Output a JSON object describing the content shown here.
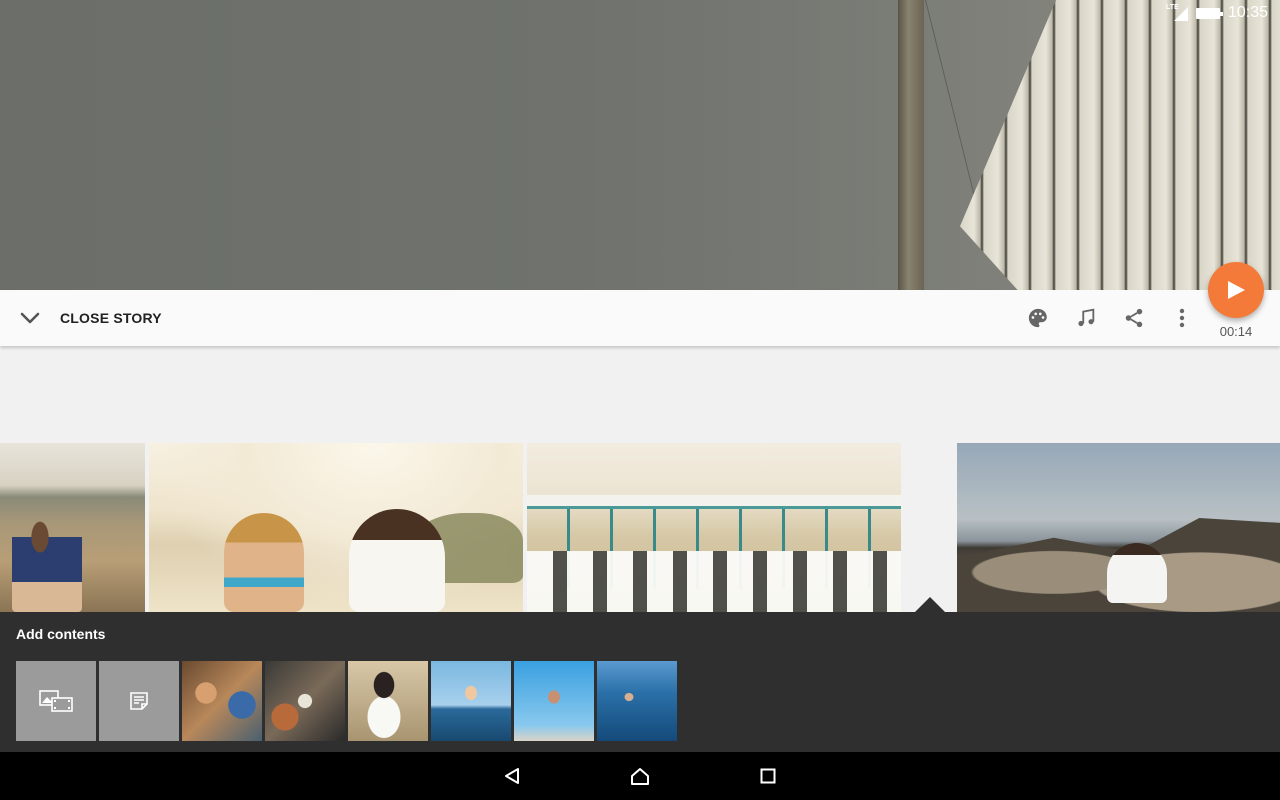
{
  "status_bar": {
    "network": "LTE",
    "time": "10:35"
  },
  "toolbar": {
    "close_label": "CLOSE STORY",
    "icons": [
      "chevron-down-icon",
      "palette-icon",
      "music-note-icon",
      "share-icon",
      "more-vert-icon"
    ]
  },
  "player": {
    "duration": "00:14",
    "accent_color": "#f47a3a"
  },
  "clips": [
    {
      "id": "clip-1"
    },
    {
      "id": "clip-2"
    },
    {
      "id": "clip-3"
    },
    {
      "id": "clip-4"
    }
  ],
  "add_panel": {
    "title": "Add contents",
    "actions": [
      "add-media-icon",
      "add-text-icon"
    ],
    "thumbnail_count": 6
  },
  "nav": {
    "icons": [
      "back-icon",
      "home-icon",
      "recents-icon"
    ]
  }
}
